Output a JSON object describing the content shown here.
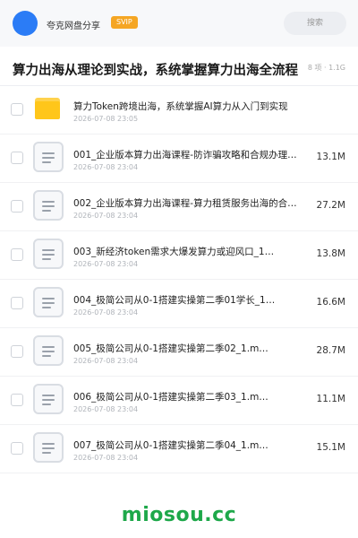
{
  "header": {
    "sharer_name": "夸克网盘分享",
    "badge": "SVIP",
    "search_placeholder": "搜索"
  },
  "share": {
    "title": "算力出海从理论到实战，系统掌握算力出海全流程",
    "meta": "8 项 · 1.1G"
  },
  "files": [
    {
      "type": "folder",
      "name": "算力Token跨境出海，系统掌握AI算力从入门到实现",
      "date": "2026-07-08 23:05",
      "size": ""
    },
    {
      "type": "file",
      "name": "001_企业版本算力出海课程-防诈骗攻略和合规办理…",
      "date": "2026-07-08 23:04",
      "size": "13.1M"
    },
    {
      "type": "file",
      "name": "002_企业版本算力出海课程-算力租赁服务出海的合…",
      "date": "2026-07-08 23:04",
      "size": "27.2M"
    },
    {
      "type": "file",
      "name": "003_新经济token需求大爆发算力或迎风口_1…",
      "date": "2026-07-08 23:04",
      "size": "13.8M"
    },
    {
      "type": "file",
      "name": "004_极简公司从0-1搭建实操第二季01学长_1…",
      "date": "2026-07-08 23:04",
      "size": "16.6M"
    },
    {
      "type": "file",
      "name": "005_极简公司从0-1搭建实操第二季02_1.m…",
      "date": "2026-07-08 23:04",
      "size": "28.7M"
    },
    {
      "type": "file",
      "name": "006_极简公司从0-1搭建实操第二季03_1.m…",
      "date": "2026-07-08 23:04",
      "size": "11.1M"
    },
    {
      "type": "file",
      "name": "007_极简公司从0-1搭建实操第二季04_1.m…",
      "date": "2026-07-08 23:04",
      "size": "15.1M"
    }
  ],
  "watermark": "miosou.cc",
  "colors": {
    "accent": "#2b7cf6",
    "svip": "#f5a623",
    "folder": "#ffc61a",
    "watermark": "#1ea84a"
  },
  "icons": {
    "folder": "folder-icon",
    "file": "document-icon",
    "avatar": "avatar"
  }
}
